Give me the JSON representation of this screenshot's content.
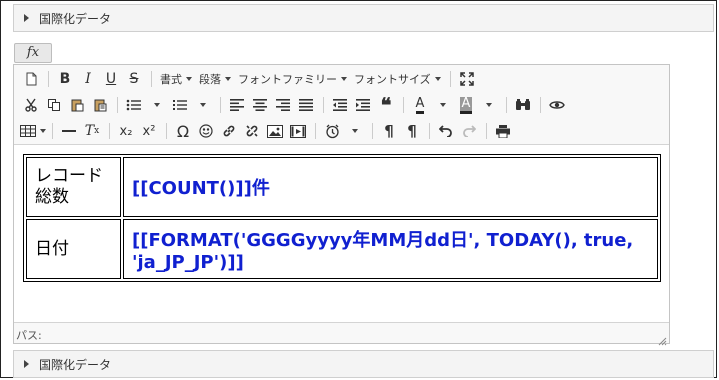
{
  "sections": {
    "top": {
      "title": "国際化データ"
    },
    "bottom": {
      "title": "国際化データ"
    }
  },
  "fx_button": {
    "label": "fx"
  },
  "toolbar": {
    "styles_label": "書式",
    "paragraph_label": "段落",
    "font_family_label": "フォントファミリー",
    "font_size_label": "フォントサイズ",
    "text_color_glyph": "A",
    "bg_color_glyph": "A",
    "subscript_glyph": "x₂",
    "superscript_glyph": "x²",
    "omega_glyph": "Ω"
  },
  "table": {
    "rows": [
      {
        "label_line1": "レコード",
        "label_line2": "総数",
        "value": "[[COUNT()]]件"
      },
      {
        "label": "日付",
        "value": "[[FORMAT('GGGGyyyy年MM月dd日', TODAY(), true, 'ja_JP_JP')]]"
      }
    ]
  },
  "status": {
    "path_label": "パス:"
  },
  "colors": {
    "value_text": "#1020d0",
    "header_bg": "#f4f4f4"
  }
}
